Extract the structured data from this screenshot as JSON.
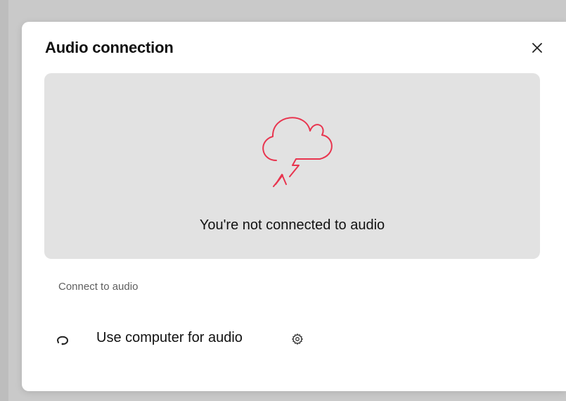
{
  "dialog": {
    "title": "Audio connection",
    "close_icon": "close-icon"
  },
  "status": {
    "icon": "disconnected-cloud-icon",
    "message": "You're not connected to audio",
    "icon_color": "#e8354f"
  },
  "connect": {
    "section_label": "Connect to audio",
    "options": [
      {
        "label": "Use computer for audio",
        "icon": "headset-icon",
        "settings_icon": "gear-icon"
      }
    ]
  }
}
